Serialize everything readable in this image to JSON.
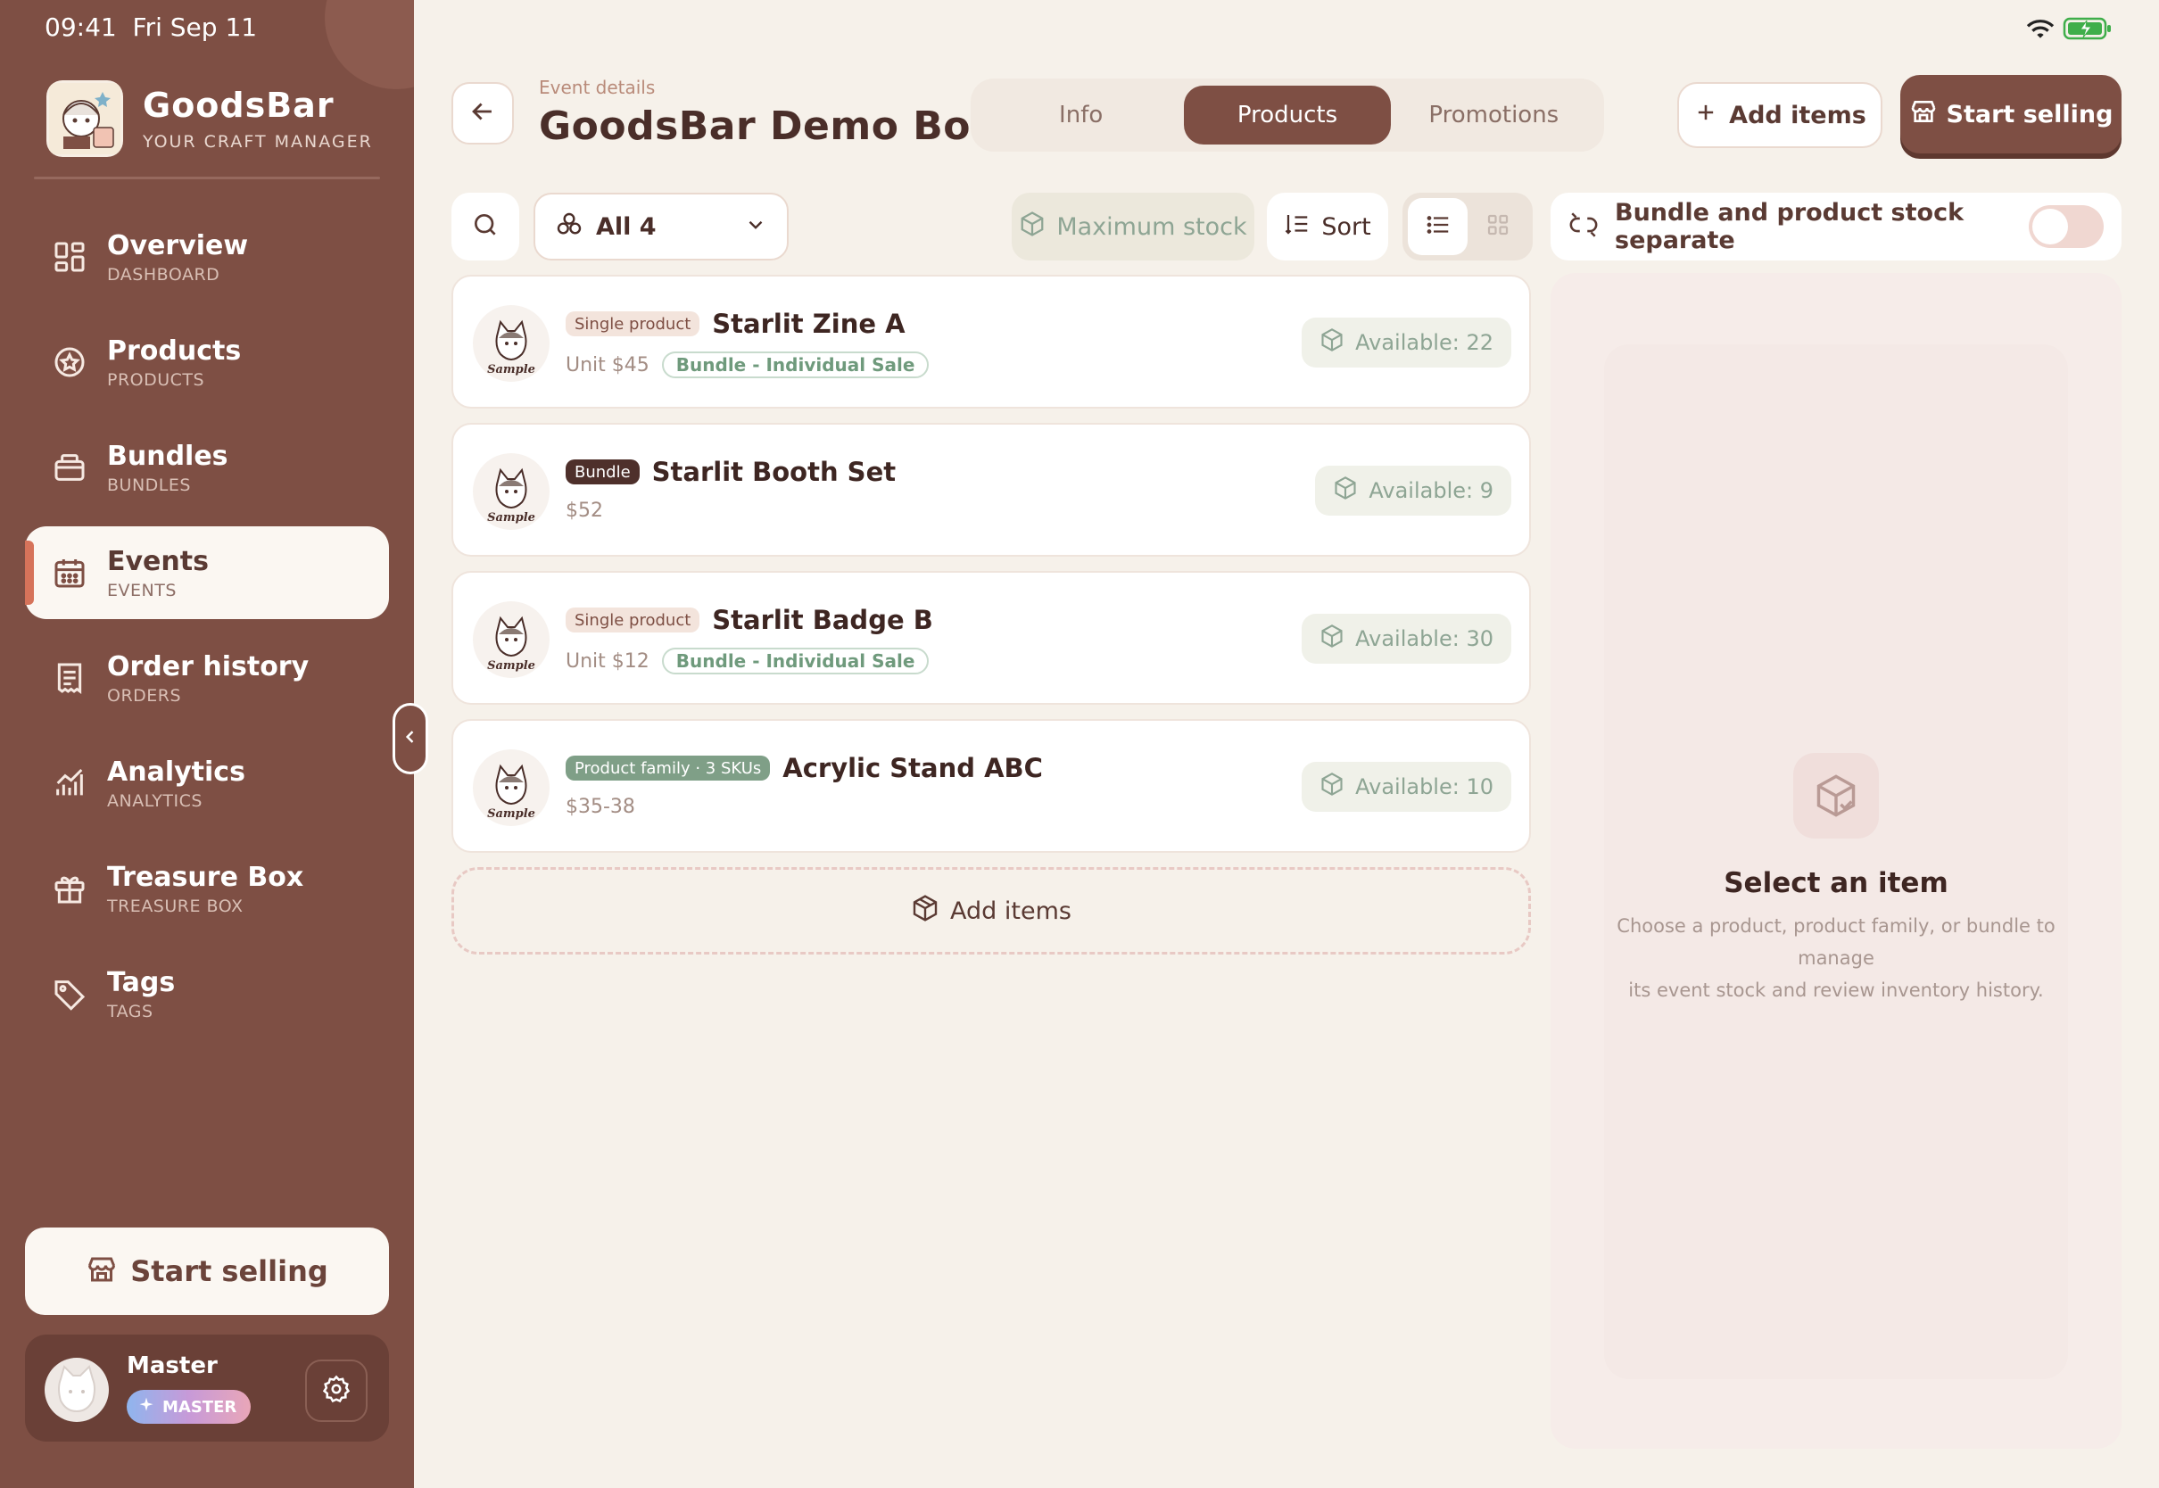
{
  "status": {
    "time": "09:41",
    "date": "Fri Sep 11"
  },
  "brand": {
    "name": "GoodsBar",
    "tagline": "YOUR CRAFT MANAGER"
  },
  "nav": [
    {
      "label": "Overview",
      "sub": "DASHBOARD",
      "icon": "grid-icon",
      "active": false
    },
    {
      "label": "Products",
      "sub": "PRODUCTS",
      "icon": "star-badge-icon",
      "active": false
    },
    {
      "label": "Bundles",
      "sub": "BUNDLES",
      "icon": "bag-icon",
      "active": false
    },
    {
      "label": "Events",
      "sub": "EVENTS",
      "icon": "calendar-icon",
      "active": true
    },
    {
      "label": "Order history",
      "sub": "ORDERS",
      "icon": "receipt-icon",
      "active": false
    },
    {
      "label": "Analytics",
      "sub": "ANALYTICS",
      "icon": "chart-icon",
      "active": false
    },
    {
      "label": "Treasure Box",
      "sub": "TREASURE BOX",
      "icon": "gift-icon",
      "active": false
    },
    {
      "label": "Tags",
      "sub": "TAGS",
      "icon": "tag-icon",
      "active": false
    }
  ],
  "sidebar_start": "Start selling",
  "user": {
    "name": "Master",
    "badge": "MASTER"
  },
  "header": {
    "crumb": "Event details",
    "title": "GoodsBar Demo Booth",
    "tabs": [
      {
        "label": "Info",
        "active": false
      },
      {
        "label": "Products",
        "active": true
      },
      {
        "label": "Promotions",
        "active": false
      }
    ],
    "add_items": "Add items",
    "start_selling": "Start selling"
  },
  "toolbar": {
    "filter": "All 4",
    "max_stock": "Maximum stock",
    "sort": "Sort",
    "bundle_toggle": "Bundle and product stock separate",
    "bundle_toggle_on": false
  },
  "items": [
    {
      "type": "Single product",
      "type_style": "single",
      "name": "Starlit Zine A",
      "price": "Unit $45",
      "pill": "Bundle - Individual Sale",
      "available": "Available: 22",
      "thumb": "Sample"
    },
    {
      "type": "Bundle",
      "type_style": "bundle",
      "name": "Starlit Booth Set",
      "price": "$52",
      "pill": "",
      "available": "Available: 9",
      "thumb": "Sample"
    },
    {
      "type": "Single product",
      "type_style": "single",
      "name": "Starlit Badge B",
      "price": "Unit $12",
      "pill": "Bundle - Individual Sale",
      "available": "Available: 30",
      "thumb": "Sample"
    },
    {
      "type": "Product family · 3 SKUs",
      "type_style": "family",
      "name": "Acrylic Stand ABC",
      "price": "$35-38",
      "pill": "",
      "available": "Available: 10",
      "thumb": "Sample"
    }
  ],
  "add_items_dashed": "Add items",
  "detail": {
    "title": "Select an item",
    "desc_line1": "Choose a product, product family, or bundle to manage",
    "desc_line2": "its event stock and review inventory history."
  },
  "colors": {
    "sidebar": "#7e4f44",
    "accent": "#d6735a",
    "available_green": "#8ea594"
  }
}
